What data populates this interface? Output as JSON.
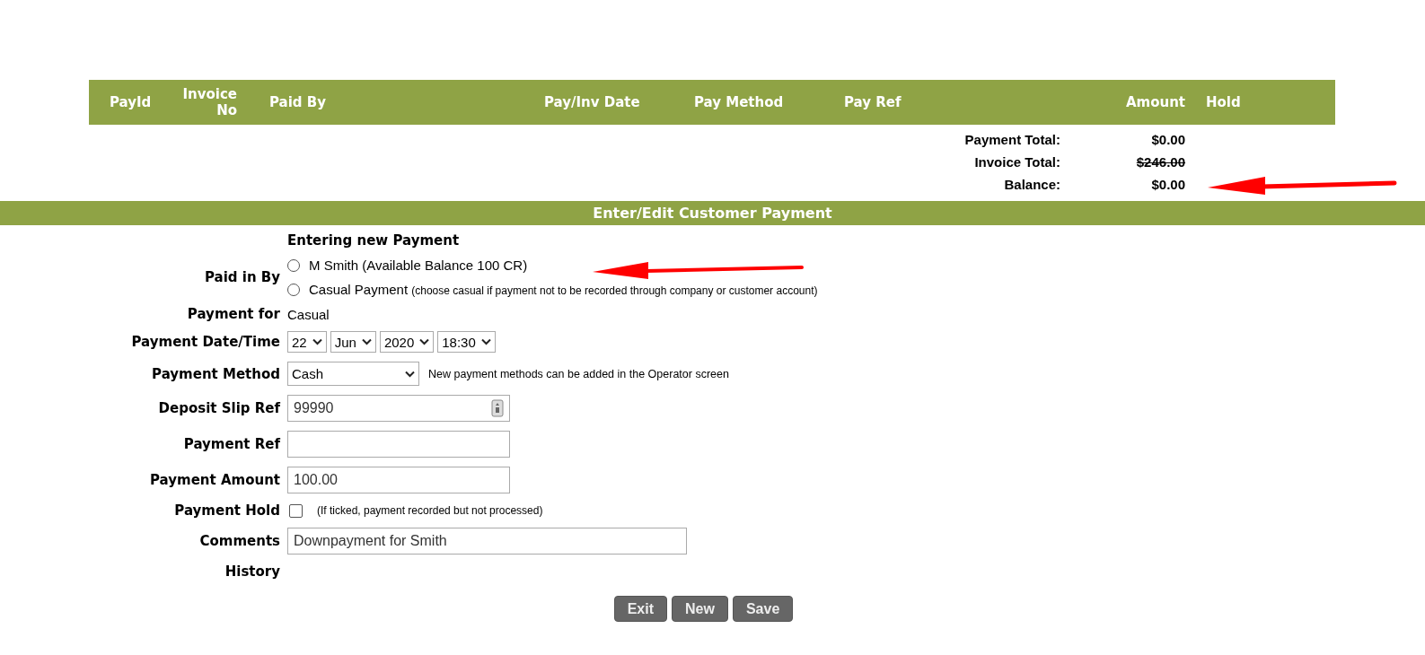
{
  "table": {
    "columns": [
      {
        "label": "PayId"
      },
      {
        "label": "Invoice No"
      },
      {
        "label": "Paid By"
      },
      {
        "label": "Pay/Inv Date"
      },
      {
        "label": "Pay Method"
      },
      {
        "label": "Pay Ref"
      },
      {
        "label": "Amount"
      },
      {
        "label": "Hold"
      }
    ]
  },
  "totals": [
    {
      "label": "Payment Total:",
      "value": "$0.00",
      "struck": false
    },
    {
      "label": "Invoice Total:",
      "value": "$246.00",
      "struck": true
    },
    {
      "label": "Balance:",
      "value": "$0.00",
      "struck": false
    }
  ],
  "section": {
    "title": "Enter/Edit Customer Payment"
  },
  "form": {
    "heading": "Entering new Payment",
    "rows": [
      {
        "kind": "radio",
        "label": "Paid in By",
        "options": [
          {
            "text": "M Smith (Available Balance 100 CR)",
            "selected": false
          },
          {
            "text": "Casual Payment",
            "note": "(choose casual if payment not to be recorded through company or customer account)",
            "selected": false
          }
        ]
      },
      {
        "kind": "text",
        "label": "Payment for",
        "value": "Casual"
      },
      {
        "kind": "date",
        "label": "Payment Date/Time",
        "selects": [
          "22",
          "Jun",
          "2020",
          "18:30"
        ]
      },
      {
        "kind": "select",
        "label": "Payment Method",
        "value": "Cash",
        "note": "New payment methods can be added in the Operator screen"
      },
      {
        "kind": "input",
        "label": "Deposit Slip Ref",
        "value": "99990",
        "icon": true,
        "wide": false
      },
      {
        "kind": "input",
        "label": "Payment Ref",
        "value": "",
        "icon": false,
        "wide": false
      },
      {
        "kind": "input",
        "label": "Payment Amount",
        "value": "100.00",
        "icon": false,
        "wide": false
      },
      {
        "kind": "checkbox",
        "label": "Payment Hold",
        "checked": false,
        "note": "(If ticked, payment recorded but not processed)"
      },
      {
        "kind": "input",
        "label": "Comments",
        "value": "Downpayment for Smith",
        "icon": false,
        "wide": true
      },
      {
        "kind": "text",
        "label": "History"
      }
    ]
  },
  "buttons": [
    {
      "label": "Exit"
    },
    {
      "label": "New"
    },
    {
      "label": "Save"
    }
  ]
}
